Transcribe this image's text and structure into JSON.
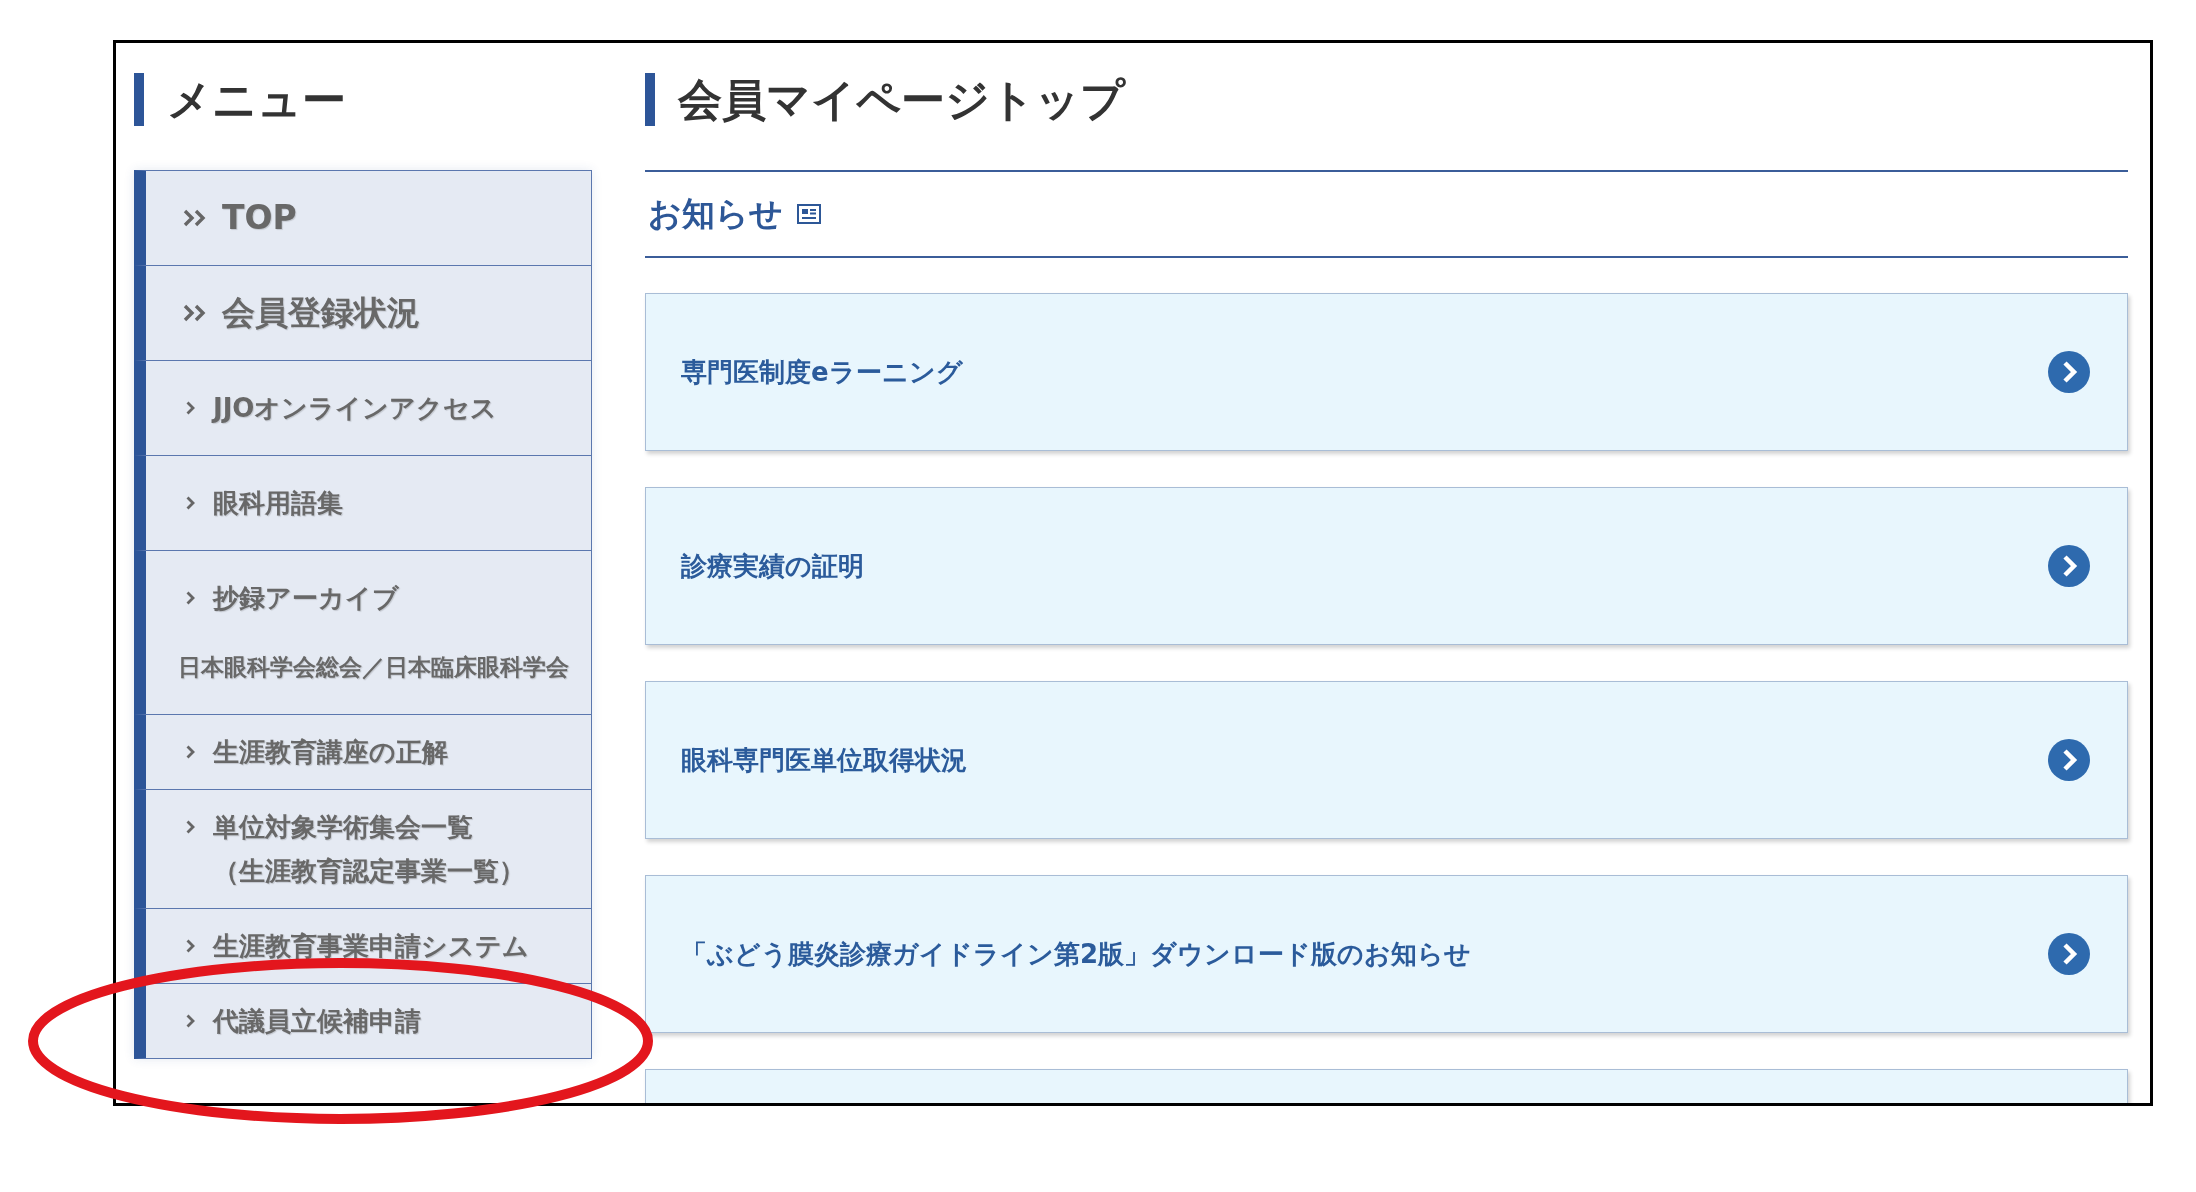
{
  "menu": {
    "title": "メニュー",
    "items": [
      {
        "kind": "major",
        "label": "TOP",
        "circled": false
      },
      {
        "kind": "major",
        "label": "会員登録状況",
        "circled": false
      },
      {
        "kind": "minor",
        "label": "JJOオンラインアクセス",
        "circled": false
      },
      {
        "kind": "minor",
        "label": "眼科用語集",
        "circled": false
      },
      {
        "kind": "minor",
        "label": "抄録アーカイブ",
        "subtitle": "日本眼科学会総会／日本臨床眼科学会",
        "circled": false
      },
      {
        "kind": "minor",
        "label": "生涯教育講座の正解",
        "circled": false
      },
      {
        "kind": "minor",
        "label": "単位対象学術集会一覧（生涯教育認定事業一覧）",
        "circled": false
      },
      {
        "kind": "minor",
        "label": "生涯教育事業申請システム",
        "circled": false
      },
      {
        "kind": "minor",
        "label": "代議員立候補申請",
        "circled": true
      }
    ]
  },
  "main": {
    "title": "会員マイページトップ",
    "section": {
      "title": "お知らせ"
    },
    "notices": [
      {
        "title": "専門医制度eラーニング"
      },
      {
        "title": "診療実績の証明"
      },
      {
        "title": "眼科専門医単位取得状況"
      },
      {
        "title": "「ぶどう膜炎診療ガイドライン第2版」ダウンロード版のお知らせ"
      }
    ]
  }
}
